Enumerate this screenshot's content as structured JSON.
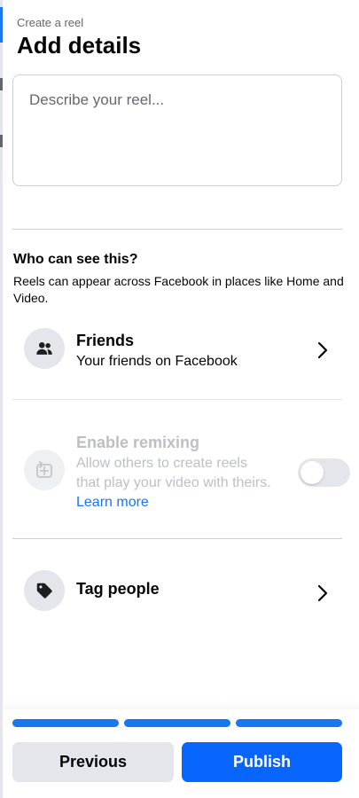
{
  "header": {
    "subtitle": "Create a reel",
    "title": "Add details"
  },
  "description": {
    "placeholder": "Describe your reel..."
  },
  "audience": {
    "title": "Who can see this?",
    "description": "Reels can appear across Facebook in places like Home and Video."
  },
  "friends_row": {
    "title": "Friends",
    "subtitle": "Your friends on Facebook",
    "icon": "friends-icon"
  },
  "remix_row": {
    "title": "Enable remixing",
    "subtitle": "Allow others to create reels that play your video with theirs.",
    "link": "Learn more",
    "icon": "remix-icon",
    "enabled": false
  },
  "tag_row": {
    "title": "Tag people",
    "icon": "tag-icon"
  },
  "progress": {
    "steps_total": 3,
    "steps_completed": 3
  },
  "footer": {
    "previous_label": "Previous",
    "publish_label": "Publish"
  },
  "colors": {
    "accent": "#1877f2",
    "publish": "#0866ff",
    "secondary_button": "#e4e6eb",
    "disabled_text": "#bcc0c4"
  }
}
